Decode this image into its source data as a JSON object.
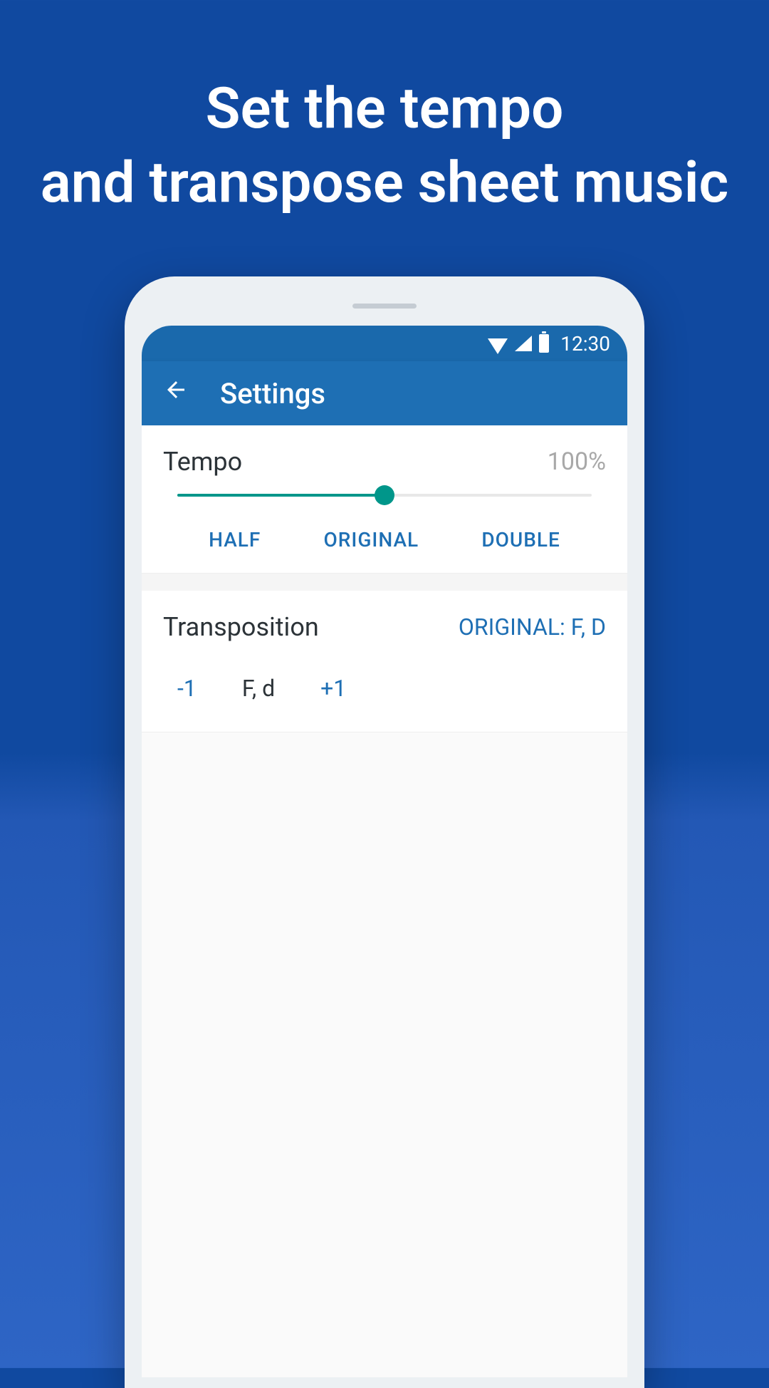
{
  "marketing": {
    "title_line1": "Set the tempo",
    "title_line2": "and transpose sheet music"
  },
  "status_bar": {
    "time": "12:30"
  },
  "app_bar": {
    "title": "Settings"
  },
  "tempo": {
    "label": "Tempo",
    "value": "100%",
    "slider_percent": 50,
    "buttons": {
      "half": "HALF",
      "original": "ORIGINAL",
      "double": "DOUBLE"
    }
  },
  "transposition": {
    "label": "Transposition",
    "original_label": "ORIGINAL: F, D",
    "decrement": "-1",
    "current": "F, d",
    "increment": "+1"
  }
}
